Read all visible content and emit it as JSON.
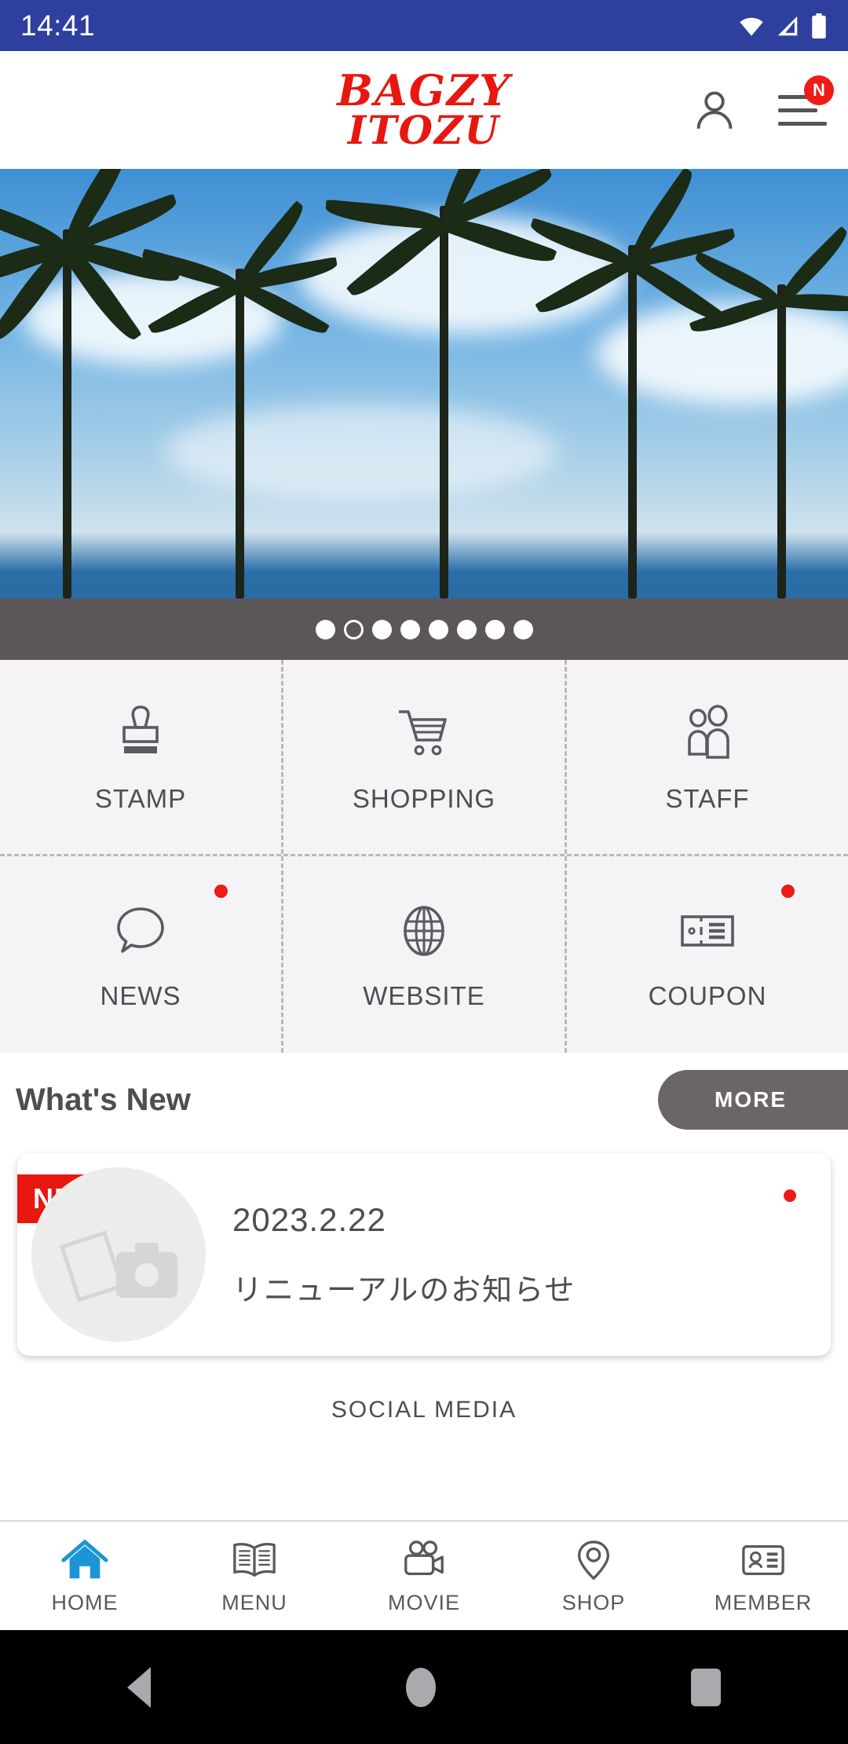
{
  "status_bar": {
    "time": "14:41",
    "icons": [
      "wifi-icon",
      "signal-icon",
      "battery-icon"
    ],
    "background_color": "#2e3f9e"
  },
  "header": {
    "logo_line1": "BAGZY",
    "logo_line2": "ITOZU",
    "logo_color": "#e8170f",
    "account_icon": "person-icon",
    "menu_icon": "hamburger-menu-icon",
    "menu_badge": "N",
    "badge_color": "#ee1b17"
  },
  "hero": {
    "description": "palm trees against blue sky beach photo",
    "carousel": {
      "total_dots": 8,
      "active_index": 1,
      "bar_color": "#5d5659"
    }
  },
  "quick_menu": {
    "rows": [
      [
        {
          "label": "STAMP",
          "icon": "stamp-icon",
          "badge": false
        },
        {
          "label": "SHOPPING",
          "icon": "shopping-cart-icon",
          "badge": false
        },
        {
          "label": "STAFF",
          "icon": "people-icon",
          "badge": false
        }
      ],
      [
        {
          "label": "NEWS",
          "icon": "speech-bubble-icon",
          "badge": true
        },
        {
          "label": "WEBSITE",
          "icon": "globe-icon",
          "badge": false
        },
        {
          "label": "COUPON",
          "icon": "coupon-ticket-icon",
          "badge": true
        }
      ]
    ],
    "badge_color": "#ec1c14"
  },
  "whats_new": {
    "title": "What's New",
    "more_label": "MORE",
    "more_color": "#6b6568",
    "items": [
      {
        "ribbon": "NEW",
        "ribbon_color": "#e8170f",
        "date": "2023.2.22",
        "title": "リニューアルのお知らせ",
        "thumb_icon": "photo-camera-placeholder-icon",
        "unread": true
      }
    ]
  },
  "social_media": {
    "title": "SOCIAL MEDIA"
  },
  "bottom_nav": {
    "active_index": 0,
    "active_color": "#1b95d4",
    "items": [
      {
        "label": "HOME",
        "icon": "home-icon"
      },
      {
        "label": "MENU",
        "icon": "open-book-icon"
      },
      {
        "label": "MOVIE",
        "icon": "video-camera-icon"
      },
      {
        "label": "SHOP",
        "icon": "map-pin-icon"
      },
      {
        "label": "MEMBER",
        "icon": "id-card-icon"
      }
    ]
  },
  "android_nav": {
    "back": "back-triangle-icon",
    "home": "home-circle-icon",
    "recents": "recents-square-icon"
  }
}
